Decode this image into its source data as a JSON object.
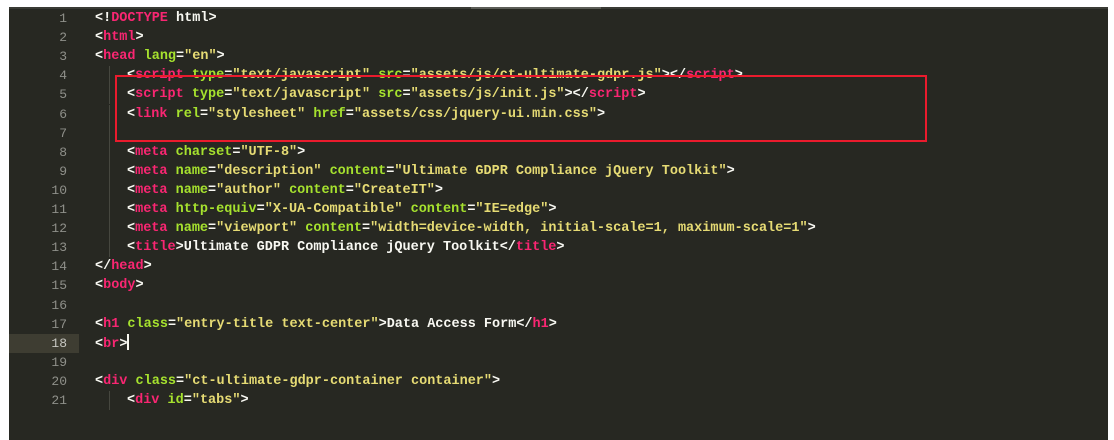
{
  "editor": {
    "active_line": "18",
    "lines": [
      {
        "no": "1",
        "indent": 0,
        "tokens": [
          [
            "punc",
            "<!"
          ],
          [
            "tag",
            "DOCTYPE"
          ],
          [
            "text",
            " html"
          ],
          [
            "punc",
            ">"
          ]
        ]
      },
      {
        "no": "2",
        "indent": 0,
        "tokens": [
          [
            "punc",
            "<"
          ],
          [
            "tag",
            "html"
          ],
          [
            "punc",
            ">"
          ]
        ]
      },
      {
        "no": "3",
        "indent": 0,
        "tokens": [
          [
            "punc",
            "<"
          ],
          [
            "tag",
            "head"
          ],
          [
            "text",
            " "
          ],
          [
            "attr",
            "lang"
          ],
          [
            "punc",
            "="
          ],
          [
            "str",
            "\"en\""
          ],
          [
            "punc",
            ">"
          ]
        ]
      },
      {
        "no": "4",
        "indent": 1,
        "tokens": [
          [
            "punc",
            "<"
          ],
          [
            "tag",
            "script"
          ],
          [
            "text",
            " "
          ],
          [
            "attr",
            "type"
          ],
          [
            "punc",
            "="
          ],
          [
            "str",
            "\"text/javascript\""
          ],
          [
            "text",
            " "
          ],
          [
            "attr",
            "src"
          ],
          [
            "punc",
            "="
          ],
          [
            "str",
            "\"assets/js/ct-ultimate-gdpr.js\""
          ],
          [
            "punc",
            "></"
          ],
          [
            "tag",
            "script"
          ],
          [
            "punc",
            ">"
          ]
        ]
      },
      {
        "no": "5",
        "indent": 1,
        "tokens": [
          [
            "punc",
            "<"
          ],
          [
            "tag",
            "script"
          ],
          [
            "text",
            " "
          ],
          [
            "attr",
            "type"
          ],
          [
            "punc",
            "="
          ],
          [
            "str",
            "\"text/javascript\""
          ],
          [
            "text",
            " "
          ],
          [
            "attr",
            "src"
          ],
          [
            "punc",
            "="
          ],
          [
            "str",
            "\"assets/js/init.js\""
          ],
          [
            "punc",
            "></"
          ],
          [
            "tag",
            "script"
          ],
          [
            "punc",
            ">"
          ]
        ]
      },
      {
        "no": "6",
        "indent": 1,
        "tokens": [
          [
            "punc",
            "<"
          ],
          [
            "tag",
            "link"
          ],
          [
            "text",
            " "
          ],
          [
            "attr",
            "rel"
          ],
          [
            "punc",
            "="
          ],
          [
            "str",
            "\"stylesheet\""
          ],
          [
            "text",
            " "
          ],
          [
            "attr",
            "href"
          ],
          [
            "punc",
            "="
          ],
          [
            "str",
            "\"assets/css/jquery-ui.min.css\""
          ],
          [
            "punc",
            ">"
          ]
        ]
      },
      {
        "no": "7",
        "indent": 1,
        "tokens": []
      },
      {
        "no": "8",
        "indent": 1,
        "tokens": [
          [
            "punc",
            "<"
          ],
          [
            "tag",
            "meta"
          ],
          [
            "text",
            " "
          ],
          [
            "attr",
            "charset"
          ],
          [
            "punc",
            "="
          ],
          [
            "str",
            "\"UTF-8\""
          ],
          [
            "punc",
            ">"
          ]
        ]
      },
      {
        "no": "9",
        "indent": 1,
        "tokens": [
          [
            "punc",
            "<"
          ],
          [
            "tag",
            "meta"
          ],
          [
            "text",
            " "
          ],
          [
            "attr",
            "name"
          ],
          [
            "punc",
            "="
          ],
          [
            "str",
            "\"description\""
          ],
          [
            "text",
            " "
          ],
          [
            "attr",
            "content"
          ],
          [
            "punc",
            "="
          ],
          [
            "str",
            "\"Ultimate GDPR Compliance jQuery Toolkit\""
          ],
          [
            "punc",
            ">"
          ]
        ]
      },
      {
        "no": "10",
        "indent": 1,
        "tokens": [
          [
            "punc",
            "<"
          ],
          [
            "tag",
            "meta"
          ],
          [
            "text",
            " "
          ],
          [
            "attr",
            "name"
          ],
          [
            "punc",
            "="
          ],
          [
            "str",
            "\"author\""
          ],
          [
            "text",
            " "
          ],
          [
            "attr",
            "content"
          ],
          [
            "punc",
            "="
          ],
          [
            "str",
            "\"CreateIT\""
          ],
          [
            "punc",
            ">"
          ]
        ]
      },
      {
        "no": "11",
        "indent": 1,
        "tokens": [
          [
            "punc",
            "<"
          ],
          [
            "tag",
            "meta"
          ],
          [
            "text",
            " "
          ],
          [
            "attr",
            "http-equiv"
          ],
          [
            "punc",
            "="
          ],
          [
            "str",
            "\"X-UA-Compatible\""
          ],
          [
            "text",
            " "
          ],
          [
            "attr",
            "content"
          ],
          [
            "punc",
            "="
          ],
          [
            "str",
            "\"IE=edge\""
          ],
          [
            "punc",
            ">"
          ]
        ]
      },
      {
        "no": "12",
        "indent": 1,
        "tokens": [
          [
            "punc",
            "<"
          ],
          [
            "tag",
            "meta"
          ],
          [
            "text",
            " "
          ],
          [
            "attr",
            "name"
          ],
          [
            "punc",
            "="
          ],
          [
            "str",
            "\"viewport\""
          ],
          [
            "text",
            " "
          ],
          [
            "attr",
            "content"
          ],
          [
            "punc",
            "="
          ],
          [
            "str",
            "\"width=device-width, initial-scale=1, maximum-scale=1\""
          ],
          [
            "punc",
            ">"
          ]
        ]
      },
      {
        "no": "13",
        "indent": 1,
        "tokens": [
          [
            "punc",
            "<"
          ],
          [
            "tag",
            "title"
          ],
          [
            "punc",
            ">"
          ],
          [
            "text",
            "Ultimate GDPR Compliance jQuery Toolkit"
          ],
          [
            "punc",
            "</"
          ],
          [
            "tag",
            "title"
          ],
          [
            "punc",
            ">"
          ]
        ]
      },
      {
        "no": "14",
        "indent": 0,
        "tokens": [
          [
            "punc",
            "</"
          ],
          [
            "tag",
            "head"
          ],
          [
            "punc",
            ">"
          ]
        ]
      },
      {
        "no": "15",
        "indent": 0,
        "tokens": [
          [
            "punc",
            "<"
          ],
          [
            "tag",
            "body"
          ],
          [
            "punc",
            ">"
          ]
        ]
      },
      {
        "no": "16",
        "indent": 0,
        "tokens": []
      },
      {
        "no": "17",
        "indent": 0,
        "tokens": [
          [
            "punc",
            "<"
          ],
          [
            "tag",
            "h1"
          ],
          [
            "text",
            " "
          ],
          [
            "attr",
            "class"
          ],
          [
            "punc",
            "="
          ],
          [
            "str",
            "\"entry-title text-center\""
          ],
          [
            "punc",
            ">"
          ],
          [
            "text",
            "Data Access Form"
          ],
          [
            "punc",
            "</"
          ],
          [
            "tag",
            "h1"
          ],
          [
            "punc",
            ">"
          ]
        ]
      },
      {
        "no": "18",
        "indent": 0,
        "tokens": [
          [
            "punc",
            "<"
          ],
          [
            "tag",
            "br"
          ],
          [
            "punc",
            ">"
          ]
        ]
      },
      {
        "no": "19",
        "indent": 0,
        "tokens": []
      },
      {
        "no": "20",
        "indent": 0,
        "tokens": [
          [
            "punc",
            "<"
          ],
          [
            "tag",
            "div"
          ],
          [
            "text",
            " "
          ],
          [
            "attr",
            "class"
          ],
          [
            "punc",
            "="
          ],
          [
            "str",
            "\"ct-ultimate-gdpr-container container\""
          ],
          [
            "punc",
            ">"
          ]
        ]
      },
      {
        "no": "21",
        "indent": 1,
        "tokens": [
          [
            "punc",
            "<"
          ],
          [
            "tag",
            "div"
          ],
          [
            "text",
            " "
          ],
          [
            "attr",
            "id"
          ],
          [
            "punc",
            "="
          ],
          [
            "str",
            "\"tabs\""
          ],
          [
            "punc",
            ">"
          ]
        ]
      }
    ]
  },
  "colors": {
    "background": "#272822",
    "tag": "#f92672",
    "attribute": "#a6e22e",
    "string": "#e6db74",
    "text": "#f8f8f2",
    "line_number": "#8f908a",
    "highlight_box": "#ea1b2d"
  },
  "annotation": {
    "highlighted_lines": [
      "4",
      "5",
      "6"
    ]
  }
}
